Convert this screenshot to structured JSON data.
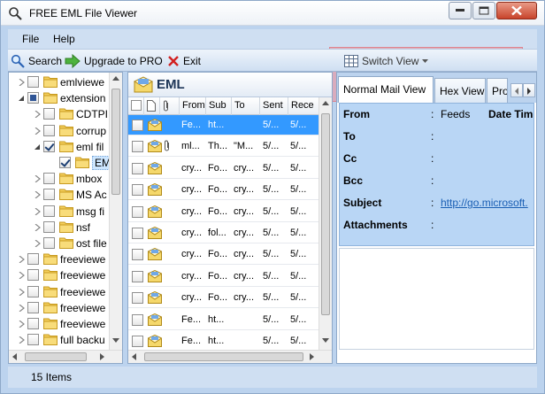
{
  "window": {
    "title": "FREE EML File Viewer"
  },
  "menu": [
    "File",
    "Help"
  ],
  "toolbar": {
    "search": "Search",
    "upgrade": "Upgrade to PRO",
    "exit": "Exit",
    "switch_view": "Switch View"
  },
  "tree": [
    {
      "label": "emlviewe",
      "state": "none",
      "expander": "collapsed"
    },
    {
      "label": "extension",
      "state": "partial",
      "expander": "expanded"
    },
    {
      "label": "CDTPI",
      "state": "none",
      "expander": "collapsed"
    },
    {
      "label": "corrup",
      "state": "none",
      "expander": "collapsed"
    },
    {
      "label": "eml fil",
      "state": "checked",
      "expander": "expanded"
    },
    {
      "label": "EM",
      "state": "checked",
      "expander": "none",
      "selected": true
    },
    {
      "label": "mbox",
      "state": "none",
      "expander": "collapsed"
    },
    {
      "label": "MS Ac",
      "state": "none",
      "expander": "collapsed"
    },
    {
      "label": "msg fi",
      "state": "none",
      "expander": "collapsed"
    },
    {
      "label": "nsf",
      "state": "none",
      "expander": "collapsed"
    },
    {
      "label": "ost file",
      "state": "none",
      "expander": "collapsed"
    },
    {
      "label": "freeviewe",
      "state": "none",
      "expander": "collapsed"
    },
    {
      "label": "freeviewe",
      "state": "none",
      "expander": "collapsed"
    },
    {
      "label": "freeviewe",
      "state": "none",
      "expander": "collapsed"
    },
    {
      "label": "freeviewe",
      "state": "none",
      "expander": "collapsed"
    },
    {
      "label": "freeviewe",
      "state": "none",
      "expander": "collapsed"
    },
    {
      "label": "full backu",
      "state": "none",
      "expander": "collapsed"
    }
  ],
  "list": {
    "title": "EML",
    "columns": [
      "From",
      "Sub",
      "To",
      "Sent",
      "Rece"
    ],
    "rows": [
      {
        "from": "Fe...",
        "sub": "ht...",
        "to": "",
        "sent": "5/...",
        "rece": "5/...",
        "attach": false,
        "selected": true
      },
      {
        "from": "ml...",
        "sub": "Th...",
        "to": "\"M...",
        "sent": "5/...",
        "rece": "5/...",
        "attach": true,
        "selected": false
      },
      {
        "from": "cry...",
        "sub": "Fo...",
        "to": "cry...",
        "sent": "5/...",
        "rece": "5/...",
        "attach": false,
        "selected": false
      },
      {
        "from": "cry...",
        "sub": "Fo...",
        "to": "cry...",
        "sent": "5/...",
        "rece": "5/...",
        "attach": false,
        "selected": false
      },
      {
        "from": "cry...",
        "sub": "Fo...",
        "to": "cry...",
        "sent": "5/...",
        "rece": "5/...",
        "attach": false,
        "selected": false
      },
      {
        "from": "cry...",
        "sub": "fol...",
        "to": "cry...",
        "sent": "5/...",
        "rece": "5/...",
        "attach": false,
        "selected": false
      },
      {
        "from": "cry...",
        "sub": "Fo...",
        "to": "cry...",
        "sent": "5/...",
        "rece": "5/...",
        "attach": false,
        "selected": false
      },
      {
        "from": "cry...",
        "sub": "Fo...",
        "to": "cry...",
        "sent": "5/...",
        "rece": "5/...",
        "attach": false,
        "selected": false
      },
      {
        "from": "cry...",
        "sub": "Fo...",
        "to": "cry...",
        "sent": "5/...",
        "rece": "5/...",
        "attach": false,
        "selected": false
      },
      {
        "from": "Fe...",
        "sub": "ht...",
        "to": "",
        "sent": "5/...",
        "rece": "5/...",
        "attach": false,
        "selected": false
      },
      {
        "from": "Fe...",
        "sub": "ht...",
        "to": "",
        "sent": "5/...",
        "rece": "5/...",
        "attach": false,
        "selected": false
      }
    ]
  },
  "preview": {
    "tabs": [
      "Normal Mail View",
      "Hex View",
      "Pro"
    ],
    "fields": [
      {
        "label": "From",
        "value": "Feeds",
        "link": false
      },
      {
        "label": "To",
        "value": "",
        "link": false
      },
      {
        "label": "Cc",
        "value": "",
        "link": false
      },
      {
        "label": "Bcc",
        "value": "",
        "link": false
      },
      {
        "label": "Subject",
        "value": "http://go.microsoft.",
        "link": true
      },
      {
        "label": "Attachments",
        "value": "",
        "link": false
      }
    ],
    "date_label": "Date Tim"
  },
  "status": {
    "items": "15 Items"
  },
  "icons": {
    "app": "magnifier-icon",
    "search": "magnifier-icon",
    "upgrade": "green-arrow-icon",
    "exit": "red-x-icon",
    "switch_view": "grid-view-icon",
    "folder": "folder-icon",
    "envelope": "envelope-icon",
    "attachment": "paperclip-icon"
  },
  "colors": {
    "selection": "#3399ff",
    "header_box": "#b9d6f5",
    "highlight": "#f08c96",
    "link": "#1a5fb4"
  }
}
